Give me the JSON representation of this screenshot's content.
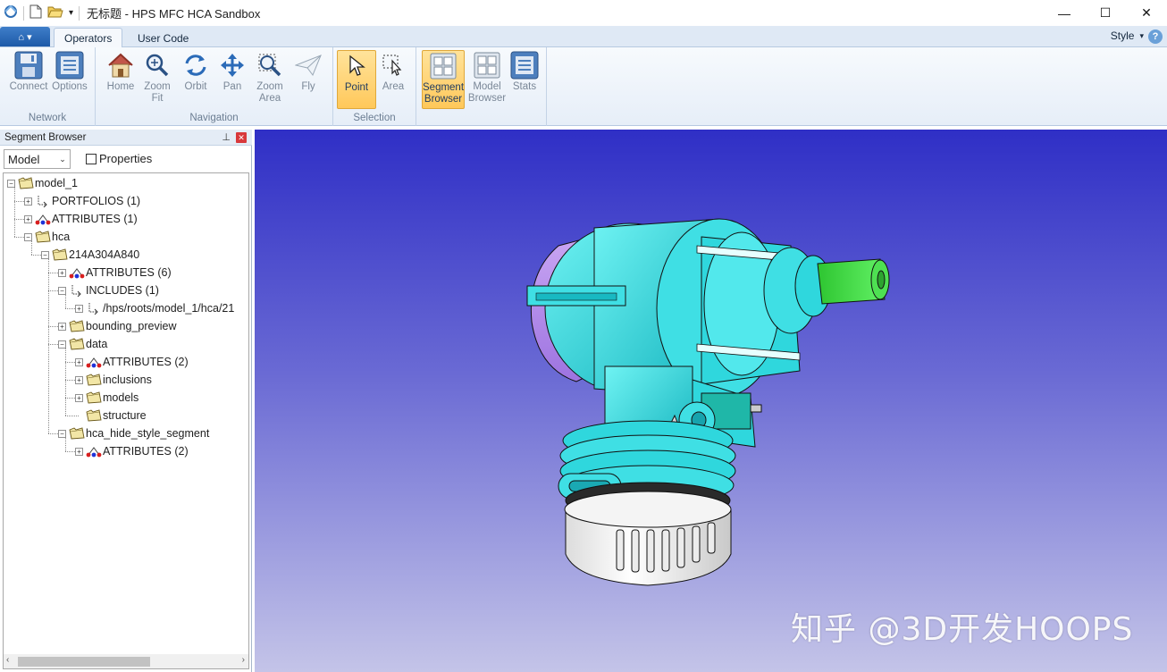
{
  "window": {
    "title": "无标题 - HPS MFC HCA Sandbox",
    "minimize_glyph": "—",
    "maximize_glyph": "☐",
    "close_glyph": "✕"
  },
  "ribbon": {
    "app_button_label": "⌂ ▾",
    "tabs": [
      {
        "label": "Operators",
        "active": true
      },
      {
        "label": "User Code",
        "active": false
      }
    ],
    "style_label": "Style",
    "style_arrow": "▾",
    "help_label": "?",
    "groups": [
      {
        "label": "Network",
        "buttons": [
          {
            "label": "Connect",
            "icon": "connect-icon"
          },
          {
            "label": "Options",
            "icon": "options-icon"
          }
        ]
      },
      {
        "label": "Navigation",
        "buttons": [
          {
            "label": "Home",
            "icon": "home-icon"
          },
          {
            "label": "Zoom Fit",
            "icon": "zoom-fit-icon"
          },
          {
            "label": "Orbit",
            "icon": "orbit-icon"
          },
          {
            "label": "Pan",
            "icon": "pan-icon"
          },
          {
            "label": "Zoom Area",
            "icon": "zoom-area-icon"
          },
          {
            "label": "Fly",
            "icon": "fly-icon"
          }
        ]
      },
      {
        "label": "Selection",
        "buttons": [
          {
            "label": "Point",
            "icon": "pointer-icon",
            "checked": true
          },
          {
            "label": "Area",
            "icon": "area-select-icon"
          }
        ]
      },
      {
        "label": "",
        "buttons": [
          {
            "label": "Segment Browser",
            "icon": "segment-browser-icon",
            "checked": true
          },
          {
            "label": "Model Browser",
            "icon": "model-browser-icon"
          },
          {
            "label": "Stats",
            "icon": "stats-icon"
          }
        ]
      }
    ]
  },
  "segment_browser": {
    "title": "Segment Browser",
    "pin_glyph": "⊥",
    "close_glyph": "✕",
    "model_select_value": "Model",
    "select_arrow": "⌄",
    "properties_label": "Properties",
    "properties_checked": false,
    "scroll_left": "‹",
    "scroll_right": "›",
    "tree": [
      {
        "label": "model_1",
        "depth": 0,
        "expander": "−",
        "icon": "folder"
      },
      {
        "label": "PORTFOLIOS (1)",
        "depth": 1,
        "expander": "+",
        "icon": "include"
      },
      {
        "label": "ATTRIBUTES (1)",
        "depth": 1,
        "expander": "+",
        "icon": "attributes"
      },
      {
        "label": "hca",
        "depth": 1,
        "expander": "−",
        "icon": "folder"
      },
      {
        "label": "214A304A840",
        "depth": 2,
        "expander": "−",
        "icon": "folder"
      },
      {
        "label": "ATTRIBUTES (6)",
        "depth": 3,
        "expander": "+",
        "icon": "attributes"
      },
      {
        "label": "INCLUDES (1)",
        "depth": 3,
        "expander": "−",
        "icon": "include"
      },
      {
        "label": "/hps/roots/model_1/hca/21",
        "depth": 4,
        "expander": "+",
        "icon": "include"
      },
      {
        "label": "bounding_preview",
        "depth": 3,
        "expander": "+",
        "icon": "folder"
      },
      {
        "label": "data",
        "depth": 3,
        "expander": "−",
        "icon": "folder"
      },
      {
        "label": "ATTRIBUTES (2)",
        "depth": 4,
        "expander": "+",
        "icon": "attributes"
      },
      {
        "label": "inclusions",
        "depth": 4,
        "expander": "+",
        "icon": "folder"
      },
      {
        "label": "models",
        "depth": 4,
        "expander": "+",
        "icon": "folder"
      },
      {
        "label": "structure",
        "depth": 4,
        "expander": "",
        "icon": "folder"
      },
      {
        "label": "hca_hide_style_segment",
        "depth": 3,
        "expander": "−",
        "icon": "folder"
      },
      {
        "label": "ATTRIBUTES (2)",
        "depth": 4,
        "expander": "+",
        "icon": "attributes"
      }
    ]
  },
  "viewport": {
    "watermark": "知乎 @3D开发HOOPS",
    "model_colors": {
      "body": "#22d8dc",
      "accent": "#b98ff0",
      "shaft": "#36e23a",
      "base": "#ffffff",
      "dark_ring": "#2a2a2a"
    }
  }
}
